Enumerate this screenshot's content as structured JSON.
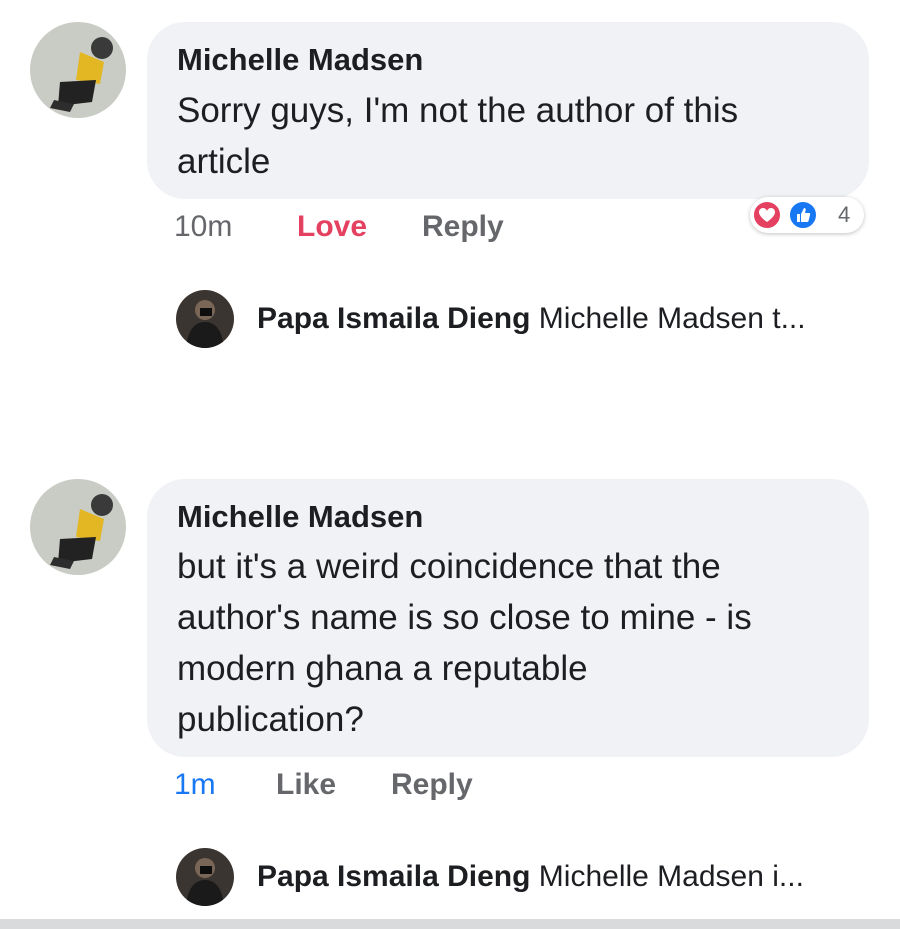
{
  "comments": [
    {
      "author": "Michelle Madsen",
      "lines": [
        "Sorry guys, I'm not the author of this",
        "article"
      ],
      "time": "10m",
      "reaction_action": "Love",
      "reply_label": "Reply",
      "reactions": {
        "icons": [
          "love-icon",
          "like-icon"
        ],
        "count": "4"
      },
      "reply_preview": {
        "name": "Papa Ismaila Dieng",
        "text": "Michelle Madsen t..."
      }
    },
    {
      "author": "Michelle Madsen",
      "lines": [
        "but it's a weird coincidence that the",
        "author's name is so close to mine - is",
        "modern ghana a reputable",
        "publication?"
      ],
      "time": "1m",
      "reaction_action": "Like",
      "reply_label": "Reply",
      "reply_preview": {
        "name": "Papa Ismaila Dieng",
        "text": "Michelle Madsen i..."
      }
    }
  ],
  "colors": {
    "bubble": "#f0f2f5",
    "love": "#e4405f",
    "like": "#1877f2",
    "muted": "#65676b"
  }
}
